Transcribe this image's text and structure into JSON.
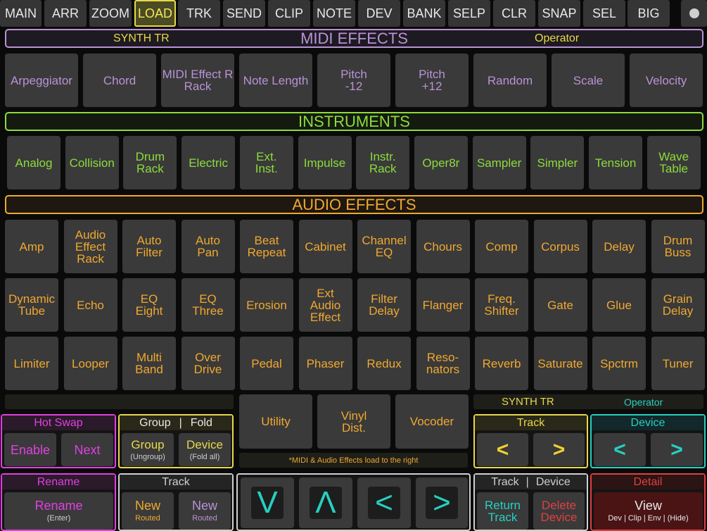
{
  "nav": [
    "MAIN",
    "ARR",
    "ZOOM",
    "LOAD",
    "TRK",
    "SEND",
    "CLIP",
    "NOTE",
    "DEV",
    "BANK",
    "SELP",
    "CLR",
    "SNAP",
    "SEL",
    "BIG"
  ],
  "midi_header": {
    "left": "SYNTH TR",
    "title": "MIDI EFFECTS",
    "right": "Operator"
  },
  "midi_effects": [
    "Arpeggiator",
    "Chord",
    "MIDI Effect R\nRack",
    "Note Length",
    "Pitch\n-12",
    "Pitch\n+12",
    "Random",
    "Scale",
    "Velocity"
  ],
  "instruments_title": "INSTRUMENTS",
  "instruments": [
    "Analog",
    "Collision",
    "Drum\nRack",
    "Electric",
    "Ext.\nInst.",
    "Impulse",
    "Instr.\nRack",
    "Oper8r",
    "Sampler",
    "Simpler",
    "Tension",
    "Wave\nTable"
  ],
  "audio_title": "AUDIO EFFECTS",
  "audio_effects": [
    [
      "Amp",
      "Audio\nEffect\nRack",
      "Auto\nFilter",
      "Auto\nPan",
      "Beat\nRepeat",
      "Cabinet",
      "Channel\nEQ",
      "Chours",
      "Comp",
      "Corpus",
      "Delay",
      "Drum\nBuss"
    ],
    [
      "Dynamic\nTube",
      "Echo",
      "EQ\nEight",
      "EQ\nThree",
      "Erosion",
      "Ext\nAudio\nEffect",
      "Filter\nDelay",
      "Flanger",
      "Freq.\nShifter",
      "Gate",
      "Glue",
      "Grain\nDelay"
    ],
    [
      "Limiter",
      "Looper",
      "Multi\nBand",
      "Over\nDrive",
      "Pedal",
      "Phaser",
      "Redux",
      "Reso-\nnators",
      "Reverb",
      "Saturate",
      "Spctrm",
      "Tuner"
    ]
  ],
  "audio_extra": [
    "Utility",
    "Vinyl\nDist.",
    "Vocoder"
  ],
  "load_note": "*MIDI & Audio Effects load to the right",
  "right_status": {
    "track": "SYNTH TR",
    "device": "Operator"
  },
  "hot_swap": {
    "title": "Hot Swap",
    "enable": "Enable",
    "next": "Next"
  },
  "group_fold": {
    "title_left": "Group",
    "title_sep": "|",
    "title_right": "Fold",
    "group": "Group",
    "group_sub": "(Ungroup)",
    "device": "Device",
    "device_sub": "(Fold all)"
  },
  "track_nav": {
    "title": "Track",
    "prev": "<",
    "next": ">"
  },
  "device_nav": {
    "title": "Device",
    "prev": "<",
    "next": ">"
  },
  "rename": {
    "title": "Rename",
    "button": "Rename",
    "sub": "(Enter)"
  },
  "track_new": {
    "title": "Track",
    "new1": "New",
    "new1_sub": "Routed",
    "new2": "New",
    "new2_sub": "Routed"
  },
  "nav_arrows": [
    "V",
    "Λ",
    "<",
    ">"
  ],
  "track_device": {
    "title_left": "Track",
    "title_sep": "|",
    "title_right": "Device",
    "return": "Return\nTrack",
    "delete": "Delete\nDevice"
  },
  "detail": {
    "title": "Detail",
    "view": "View",
    "sub": "Dev | Clip | Env | (Hide)"
  },
  "colors": {
    "midi": "#b993d6",
    "instrument": "#8cdc3c",
    "audio": "#f0a830",
    "hotswap": "#e040e0",
    "group": "#e8d84a",
    "device": "#26d0c0",
    "detail": "#e04040",
    "track": "#cfcfcf"
  }
}
